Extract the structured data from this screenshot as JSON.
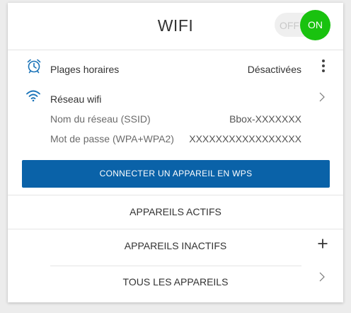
{
  "header": {
    "title": "WIFI",
    "toggle": {
      "off_label": "OFF",
      "on_label": "ON",
      "state": "on",
      "color": "#19c20f"
    }
  },
  "schedule": {
    "icon": "alarm-clock-icon",
    "label": "Plages horaires",
    "value": "Désactivées",
    "menu_icon": "more-vertical-icon"
  },
  "network": {
    "icon": "wifi-icon",
    "label": "Réseau wifi",
    "chevron_icon": "chevron-right-icon",
    "ssid_label": "Nom du réseau (SSID)",
    "ssid_value": "Bbox-XXXXXXX",
    "password_label": "Mot de passe (WPA+WPA2)",
    "password_value": "XXXXXXXXXXXXXXXXX"
  },
  "wps_button": {
    "label": "CONNECTER UN APPAREIL EN WPS",
    "color": "#0a62a8"
  },
  "sections": {
    "active": "APPAREILS ACTIFS",
    "inactive": "APPAREILS INACTIFS",
    "inactive_icon": "plus-icon",
    "all": "TOUS LES APPAREILS",
    "all_icon": "chevron-right-icon"
  },
  "colors": {
    "accent": "#1a73b8",
    "on": "#19c20f",
    "button": "#0a62a8"
  }
}
